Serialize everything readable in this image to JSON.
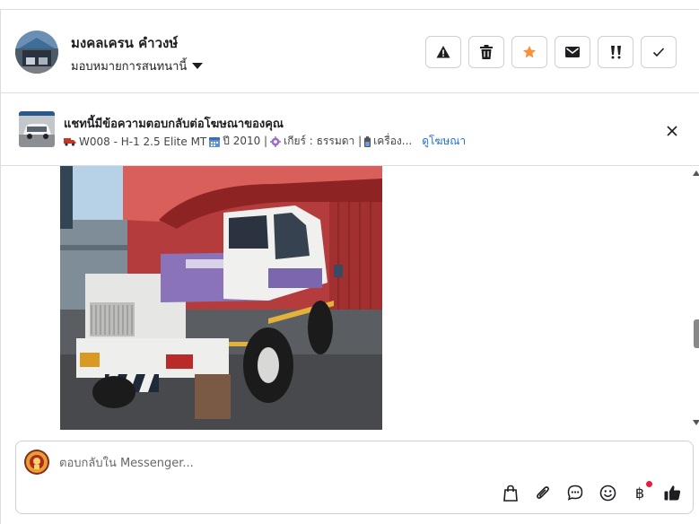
{
  "contact": {
    "name": "มงคลเครน คำวงษ์",
    "assign_label": "มอบหมายการสนทนานี้"
  },
  "header_actions": [
    {
      "icon": "warning-icon"
    },
    {
      "icon": "trash-icon"
    },
    {
      "icon": "star-icon",
      "color": "#f7923b"
    },
    {
      "icon": "envelope-icon"
    },
    {
      "icon": "follow-up-icon"
    },
    {
      "icon": "check-icon"
    }
  ],
  "ad_banner": {
    "title": "แชทนี้มีข้อความตอบกลับต่อโฆษณาของคุณ",
    "model": "W008 - H-1 2.5 Elite MT",
    "year": "ปี 2010 |",
    "gear": "เกียร์ : ธรรมดา |",
    "engine": "เครื่อง...",
    "view_ad_link": "ดูโฆษณา"
  },
  "composer": {
    "placeholder": "ตอบกลับใน Messenger...",
    "tools": [
      "bag-icon",
      "paperclip-icon",
      "quick-reply-icon",
      "emoji-icon",
      "baht-icon",
      "thumbs-up-icon"
    ],
    "baht_symbol": "฿"
  },
  "colors": {
    "accent": "#1f6fd1",
    "star": "#f7923b",
    "notification": "#e41e3f"
  }
}
